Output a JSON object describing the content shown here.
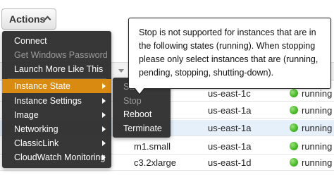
{
  "actions_button": {
    "label": "Actions",
    "icon": "chevron-up-icon"
  },
  "menu": {
    "items": [
      {
        "label": "Connect",
        "state": "enabled",
        "submenu": false
      },
      {
        "label": "Get Windows Password",
        "state": "disabled",
        "submenu": false
      },
      {
        "label": "Launch More Like This",
        "state": "enabled",
        "submenu": false
      },
      {
        "label": "Instance State",
        "state": "active",
        "submenu": true
      },
      {
        "label": "Instance Settings",
        "state": "enabled",
        "submenu": true
      },
      {
        "label": "Image",
        "state": "enabled",
        "submenu": true
      },
      {
        "label": "Networking",
        "state": "enabled",
        "submenu": true
      },
      {
        "label": "ClassicLink",
        "state": "enabled",
        "submenu": true
      },
      {
        "label": "CloudWatch Monitoring",
        "state": "enabled",
        "submenu": true
      }
    ]
  },
  "submenu": {
    "items": [
      {
        "label": "Start",
        "state": "disabled"
      },
      {
        "label": "Stop",
        "state": "disabled"
      },
      {
        "label": "Reboot",
        "state": "enabled"
      },
      {
        "label": "Terminate",
        "state": "enabled"
      }
    ]
  },
  "tooltip": {
    "text": "Stop is not supported for instances that are in the following states (running). When stopping please only select instances that are (running, pending, stopping, shutting-down)."
  },
  "table": {
    "rows": [
      {
        "type": "",
        "zone": "us-east-1c",
        "state": "running",
        "highlighted": false
      },
      {
        "type": "",
        "zone": "us-east-1a",
        "state": "running",
        "highlighted": false
      },
      {
        "type": "",
        "zone": "us-east-1a",
        "state": "running",
        "highlighted": true
      },
      {
        "type": "m1.small",
        "zone": "us-east-1a",
        "state": "running",
        "highlighted": false
      },
      {
        "type": "c3.2xlarge",
        "zone": "us-east-1d",
        "state": "running",
        "highlighted": false
      }
    ]
  },
  "colors": {
    "menu_bg": "#282828",
    "active_item": "#d98a10",
    "running_dot": "#4cbb2c",
    "highlight_row": "#e6f0fb"
  }
}
